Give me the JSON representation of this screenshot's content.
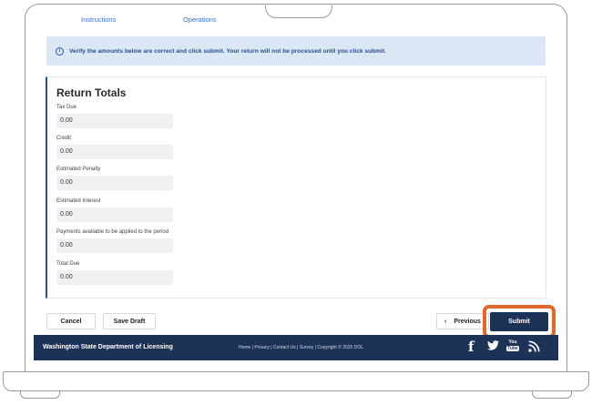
{
  "nav": {
    "tab_instructions": "Instructions",
    "tab_operations": "Operations"
  },
  "alert": {
    "icon": "info-icon",
    "message": "Verify the amounts below are correct and click submit. Your return will not be processed until you click submit."
  },
  "return_totals": {
    "title": "Return Totals",
    "fields": [
      {
        "label": "Tax Due",
        "value": "0.00"
      },
      {
        "label": "Credit",
        "value": "0.00"
      },
      {
        "label": "Estimated Penalty",
        "value": "0.00"
      },
      {
        "label": "Estimated Interest",
        "value": "0.00"
      },
      {
        "label": "Payments available to be applied to the period",
        "value": "0.00"
      },
      {
        "label": "Total Due",
        "value": "0.00"
      }
    ]
  },
  "actions": {
    "cancel": "Cancel",
    "save_draft": "Save Draft",
    "previous": "Previous",
    "submit": "Submit"
  },
  "footer": {
    "org": "Washington State Department of Licensing",
    "links": "Home | Privacy | Contact Us | Survey | Copyright © 2025 DOL",
    "youtube_you": "You",
    "youtube_tube": "Tube"
  },
  "colors": {
    "navy": "#1d3257",
    "alert_bg": "#dbe7f4",
    "highlight": "#e0682f"
  }
}
